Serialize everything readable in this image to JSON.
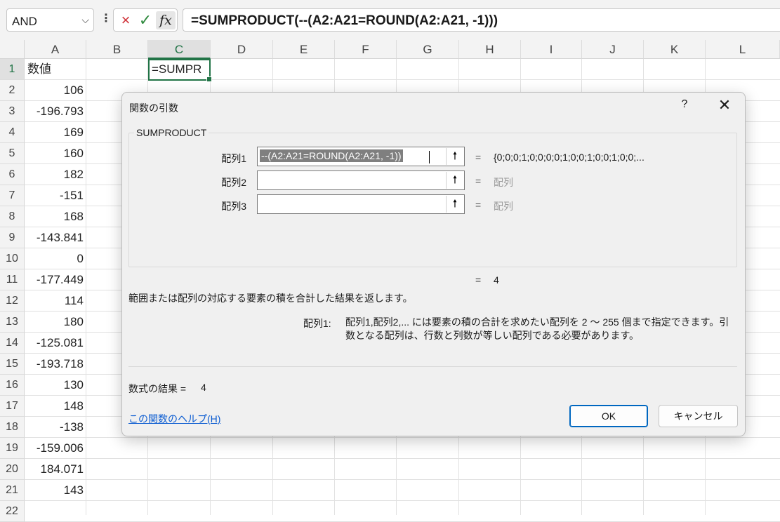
{
  "formula_bar": {
    "name_box": "AND",
    "cancel_icon": "×",
    "enter_icon": "✓",
    "fx_icon": "fx",
    "formula": "=SUMPRODUCT(--(A2:A21=ROUND(A2:A21, -1)))"
  },
  "columns": [
    "A",
    "B",
    "C",
    "D",
    "E",
    "F",
    "G",
    "H",
    "I",
    "J",
    "K",
    "L"
  ],
  "rows": [
    "1",
    "2",
    "3",
    "4",
    "5",
    "6",
    "7",
    "8",
    "9",
    "10",
    "11",
    "12",
    "13",
    "14",
    "15",
    "16",
    "17",
    "18",
    "19",
    "20",
    "21",
    "22"
  ],
  "column_a": [
    "数値",
    "106",
    "-196.793",
    "169",
    "160",
    "182",
    "-151",
    "168",
    "-143.841",
    "0",
    "-177.449",
    "114",
    "180",
    "-125.081",
    "-193.718",
    "130",
    "148",
    "-138",
    "-159.006",
    "184.071",
    "143"
  ],
  "active_cell": {
    "ref": "C1",
    "content": "=SUMPR"
  },
  "dialog": {
    "title": "関数の引数",
    "help_button": "?",
    "close_button": "✕",
    "function_name": "SUMPRODUCT",
    "args": [
      {
        "label": "配列1",
        "value": "--(A2:A21=ROUND(A2:A21, -1))",
        "result": "{0;0;0;1;0;0;0;0;1;0;0;1;0;0;1;0;0;..."
      },
      {
        "label": "配列2",
        "value": "",
        "result": "配列"
      },
      {
        "label": "配列3",
        "value": "",
        "result": "配列"
      }
    ],
    "equals": "=",
    "total_result": "4",
    "description": "範囲または配列の対応する要素の積を合計した結果を返します。",
    "arg_desc_label": "配列1:",
    "arg_desc_text": "配列1,配列2,... には要素の積の合計を求めたい配列を 2 ～ 255 個まで指定できます。引数となる配列は、行数と列数が等しい配列である必要があります。",
    "formula_result_label": "数式の結果 =",
    "formula_result_value": "4",
    "help_link": "この関数のヘルプ(H)",
    "ok_label": "OK",
    "cancel_label": "キャンセル"
  },
  "colors": {
    "accent": "#217346",
    "link": "#0a5bd1",
    "ok_border": "#0067c0"
  }
}
